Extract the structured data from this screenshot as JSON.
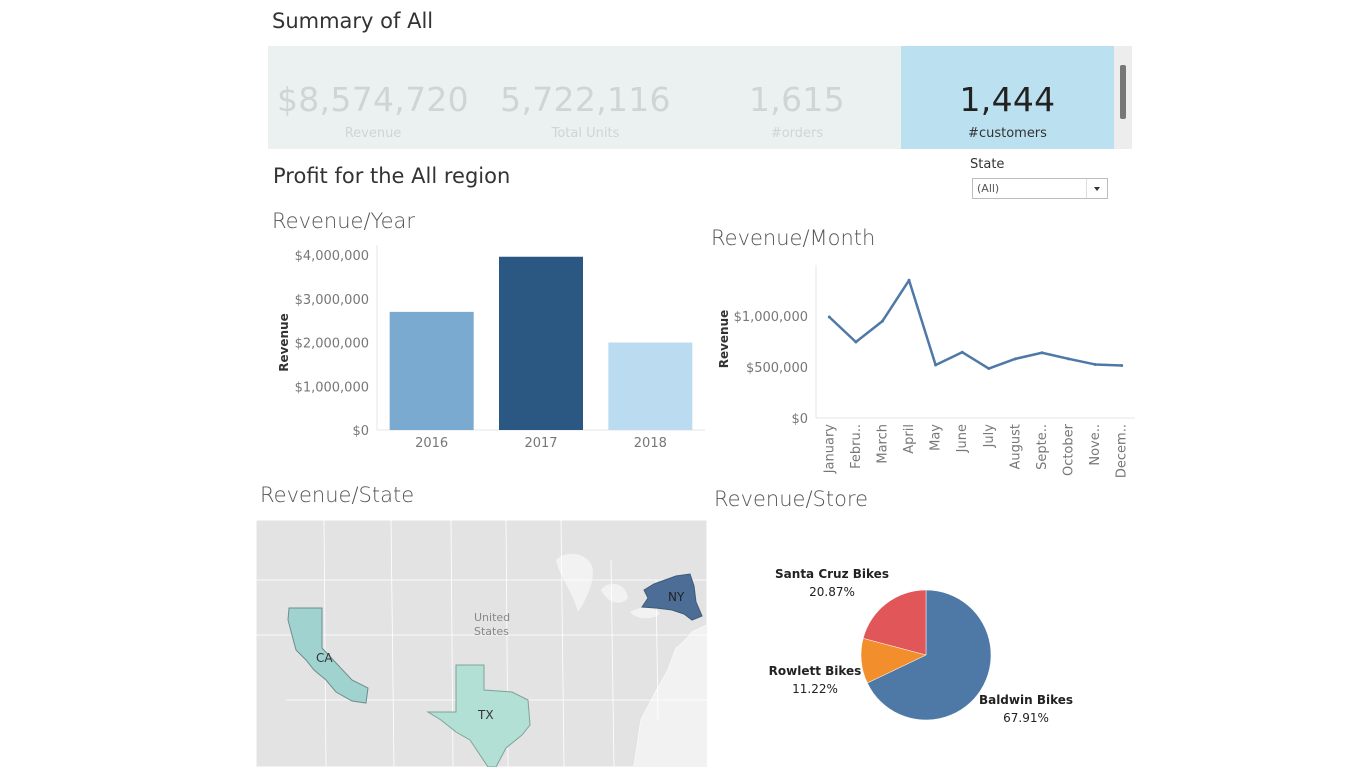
{
  "summary": {
    "title": "Summary of All",
    "kpis": [
      {
        "value": "$8,574,720",
        "label": "Revenue"
      },
      {
        "value": "5,722,116",
        "label": "Total Units"
      },
      {
        "value": "1,615",
        "label": "#orders"
      },
      {
        "value": "1,444",
        "label": "#customers"
      }
    ]
  },
  "profit_title": "Profit for the All region",
  "filter": {
    "label": "State",
    "value": "(All)"
  },
  "colors": {
    "year_2016": "#7aaad0",
    "year_2017": "#2b5783",
    "year_2018": "#bbdcf0",
    "line": "#4e79a7",
    "baldwin": "#4e79a7",
    "rowlett": "#f28e2b",
    "santa_cruz": "#e15759",
    "map_ca": "#a0d2d0",
    "map_tx": "#b3e0d4",
    "map_ny": "#4c6e96"
  },
  "chart_data": [
    {
      "type": "bar",
      "title": "Revenue/Year",
      "ylabel": "Revenue",
      "categories": [
        "2016",
        "2017",
        "2018"
      ],
      "values": [
        2700000,
        3960000,
        2000000
      ],
      "ylim": [
        0,
        4000000
      ],
      "yticks": [
        0,
        1000000,
        2000000,
        3000000,
        4000000
      ],
      "ytick_labels": [
        "$0",
        "$1,000,000",
        "$2,000,000",
        "$3,000,000",
        "$4,000,000"
      ]
    },
    {
      "type": "line",
      "title": "Revenue/Month",
      "ylabel": "Revenue",
      "categories": [
        "January",
        "Febru..",
        "March",
        "April",
        "May",
        "June",
        "July",
        "August",
        "Septe..",
        "October",
        "Nove..",
        "Decem.."
      ],
      "values": [
        990000,
        745000,
        950000,
        1350000,
        520000,
        645000,
        485000,
        580000,
        640000,
        580000,
        525000,
        515000
      ],
      "ylim": [
        0,
        1500000
      ],
      "yticks": [
        0,
        500000,
        1000000
      ],
      "ytick_labels": [
        "$0",
        "$500,000",
        "$1,000,000"
      ]
    },
    {
      "type": "pie",
      "title": "Revenue/Store",
      "slices": [
        {
          "name": "Baldwin Bikes",
          "pct": "67.91%",
          "value": 67.91
        },
        {
          "name": "Rowlett Bikes",
          "pct": "11.22%",
          "value": 11.22
        },
        {
          "name": "Santa Cruz Bikes",
          "pct": "20.87%",
          "value": 20.87
        }
      ]
    }
  ],
  "map": {
    "title": "Revenue/State",
    "country_label": [
      "United",
      "States"
    ],
    "states": [
      {
        "abbr": "CA"
      },
      {
        "abbr": "TX"
      },
      {
        "abbr": "NY"
      }
    ]
  }
}
